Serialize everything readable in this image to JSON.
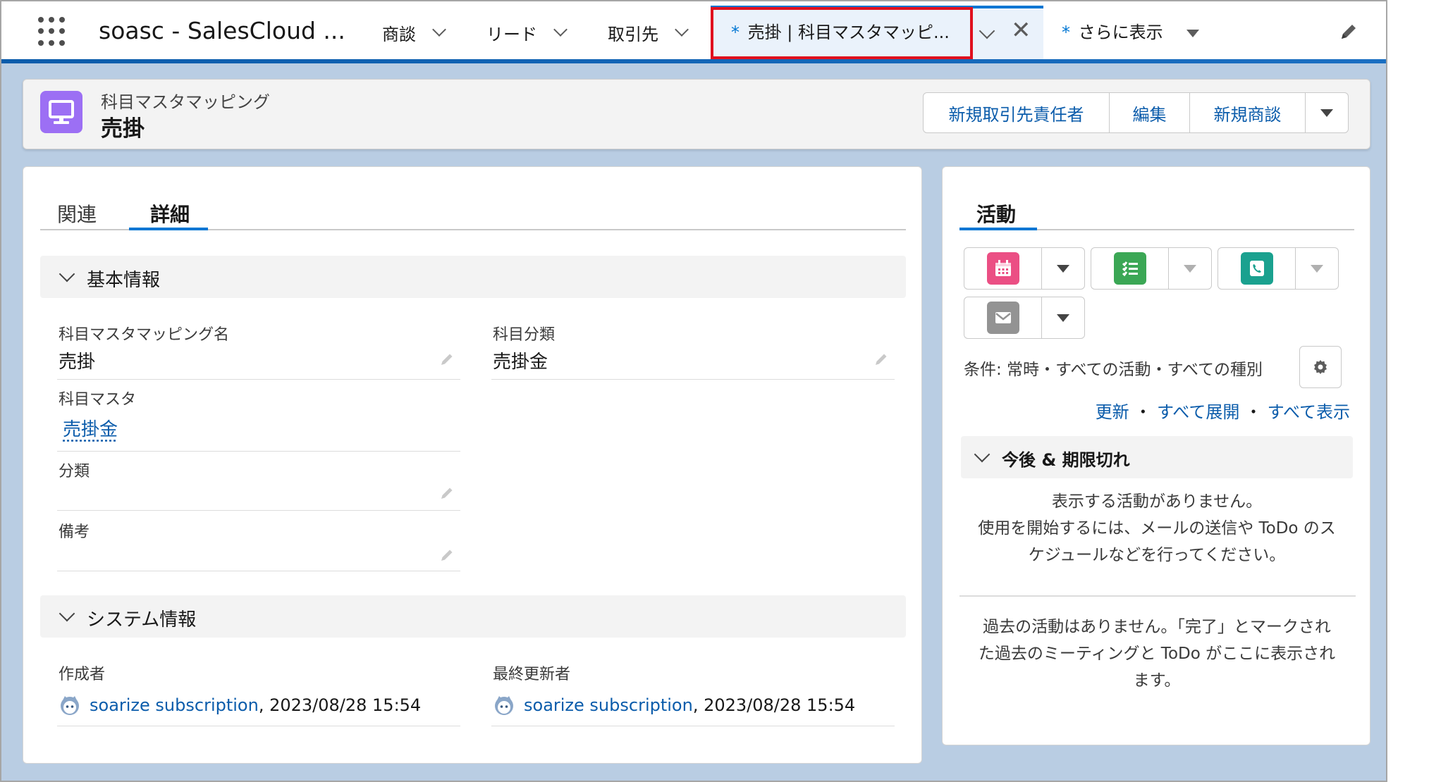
{
  "nav": {
    "app_name": "soasc - SalesCloud ...",
    "items": [
      {
        "label": "商談"
      },
      {
        "label": "リード"
      },
      {
        "label": "取引先"
      }
    ],
    "active_tab_marker": "*",
    "active_tab_label": "売掛 | 科目マスタマッピ...",
    "more_marker": "*",
    "more_label": "さらに表示"
  },
  "record": {
    "object_type": "科目マスタマッピング",
    "title": "売掛",
    "buttons": [
      {
        "label": "新規取引先責任者"
      },
      {
        "label": "編集"
      },
      {
        "label": "新規商談"
      }
    ]
  },
  "tabs": {
    "related": "関連",
    "details": "詳細"
  },
  "sections": {
    "basic": "基本情報",
    "system": "システム情報"
  },
  "fields": {
    "mapping_name": {
      "label": "科目マスタマッピング名",
      "value": "売掛"
    },
    "category": {
      "label": "科目分類",
      "value": "売掛金"
    },
    "master": {
      "label": "科目マスタ",
      "value": "売掛金"
    },
    "classification": {
      "label": "分類",
      "value": ""
    },
    "remarks": {
      "label": "備考",
      "value": ""
    },
    "created_by": {
      "label": "作成者",
      "user": "soarize subscription",
      "date": ", 2023/08/28 15:54"
    },
    "modified_by": {
      "label": "最終更新者",
      "user": "soarize subscription",
      "date": ", 2023/08/28 15:54"
    }
  },
  "activity": {
    "tab": "活動",
    "filter": "条件: 常時・すべての活動・すべての種別",
    "links": {
      "refresh": "更新",
      "expand": "すべて展開",
      "view_all": "すべて表示",
      "sep": "・"
    },
    "upcoming_title": "今後 & 期限切れ",
    "empty": [
      "表示する活動がありません。",
      "使用を開始するには、メールの送信や ToDo のス",
      "ケジュールなどを行ってください。"
    ],
    "past": [
      "過去の活動はありません。「完了」とマークされ",
      "た過去のミーティングと ToDo がここに表示され",
      "ます。"
    ]
  },
  "colors": {
    "accent": "#0176d3",
    "link": "#0b5cab",
    "record_icon": "#9c6ff4",
    "event_icon": "#eb4f84",
    "task_icon": "#3ba755",
    "call_icon": "#1aa18f",
    "email_icon": "#939393",
    "highlight_box": "#e0101e"
  }
}
